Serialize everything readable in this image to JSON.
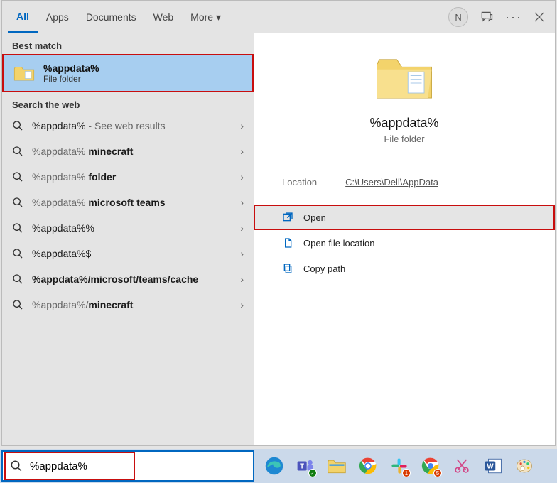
{
  "tabs": {
    "all": "All",
    "apps": "Apps",
    "documents": "Documents",
    "web": "Web",
    "more": "More"
  },
  "avatar_letter": "N",
  "sections": {
    "best_match": "Best match",
    "search_web": "Search the web"
  },
  "best_match": {
    "title": "%appdata%",
    "subtitle": "File folder"
  },
  "web_results": [
    {
      "q": "%appdata%",
      "suffix": " - See web results"
    },
    {
      "q": "%appdata% minecraft"
    },
    {
      "q": "%appdata% folder"
    },
    {
      "q": "%appdata% microsoft teams"
    },
    {
      "q": "%appdata%%"
    },
    {
      "q": "%appdata%$"
    },
    {
      "q": "%appdata%/microsoft/teams/cache"
    },
    {
      "q": "%appdata%/minecraft"
    }
  ],
  "detail": {
    "title": "%appdata%",
    "subtitle": "File folder",
    "location_label": "Location",
    "location_value": "C:\\Users\\Dell\\AppData",
    "open": "Open",
    "open_location": "Open file location",
    "copy_path": "Copy path"
  },
  "search_value": "%appdata%"
}
